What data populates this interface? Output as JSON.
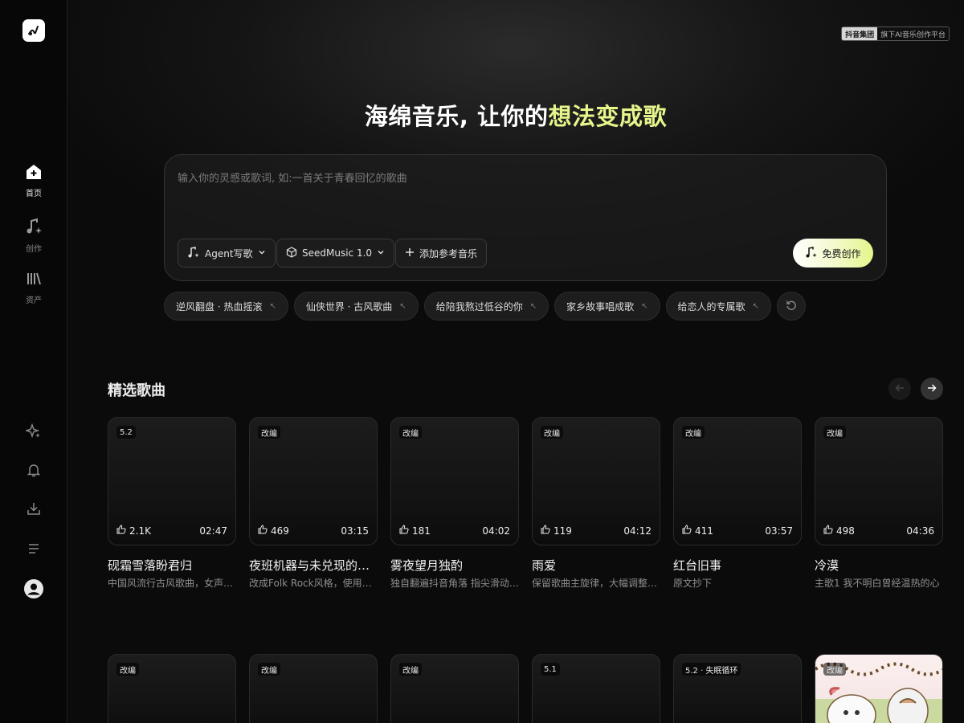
{
  "sidebar": {
    "items": [
      {
        "label": "首页",
        "icon": "home-icon",
        "active": true
      },
      {
        "label": "创作",
        "icon": "music-sparkle-icon",
        "active": false
      },
      {
        "label": "资产",
        "icon": "library-icon",
        "active": false
      }
    ],
    "bottom_icons": [
      "sparkle-icon",
      "bell-icon",
      "download-icon",
      "menu-icon",
      "avatar-icon"
    ]
  },
  "badge": {
    "brand": "抖音集团",
    "text": "旗下AI音乐创作平台"
  },
  "hero": {
    "title_part1": "海绵音乐, 让你的",
    "title_accent": "想法变成歌"
  },
  "prompt": {
    "placeholder": "输入你的灵感或歌词, 如:一首关于青春回忆的歌曲",
    "agent_label": "Agent写歌",
    "model_label": "SeedMusic 1.0",
    "add_ref_label": "添加参考音乐",
    "create_label": "免费创作"
  },
  "suggestions": [
    "逆风翻盘 · 热血摇滚",
    "仙侠世界 · 古风歌曲",
    "给陪我熬过低谷的你",
    "家乡故事唱成歌",
    "给恋人的专属歌"
  ],
  "section": {
    "title": "精选歌曲"
  },
  "songs": [
    {
      "tag": "5.2",
      "likes": "2.1K",
      "duration": "02:47",
      "title": "砚霜雪落盼君归",
      "desc": "中国风流行古风歌曲，女声演唱"
    },
    {
      "tag": "改编",
      "likes": "469",
      "duration": "03:15",
      "title": "夜班机器与未兑现的约定",
      "desc": "改成Folk Rock风格，使用A大调"
    },
    {
      "tag": "改编",
      "likes": "181",
      "duration": "04:02",
      "title": "雾夜望月独酌",
      "desc": "独自翻遍抖音角落 指尖滑动着寂寞"
    },
    {
      "tag": "改编",
      "likes": "119",
      "duration": "04:12",
      "title": "雨爱",
      "desc": "保留歌曲主旋律，大幅调整编曲风格"
    },
    {
      "tag": "改编",
      "likes": "411",
      "duration": "03:57",
      "title": "红台旧事",
      "desc": "原文抄下"
    },
    {
      "tag": "改编",
      "likes": "498",
      "duration": "04:36",
      "title": "冷漠",
      "desc": "主歌1 我不明白曾经温热的心"
    }
  ],
  "songs_row2": [
    {
      "tag": "改编"
    },
    {
      "tag": "改编"
    },
    {
      "tag": "改编"
    },
    {
      "tag": "5.1"
    },
    {
      "tag": "5.2 · 失眠循环"
    },
    {
      "tag": "改编"
    }
  ],
  "colors": {
    "accent": "#e7f58b",
    "background": "#0b0b0b"
  }
}
